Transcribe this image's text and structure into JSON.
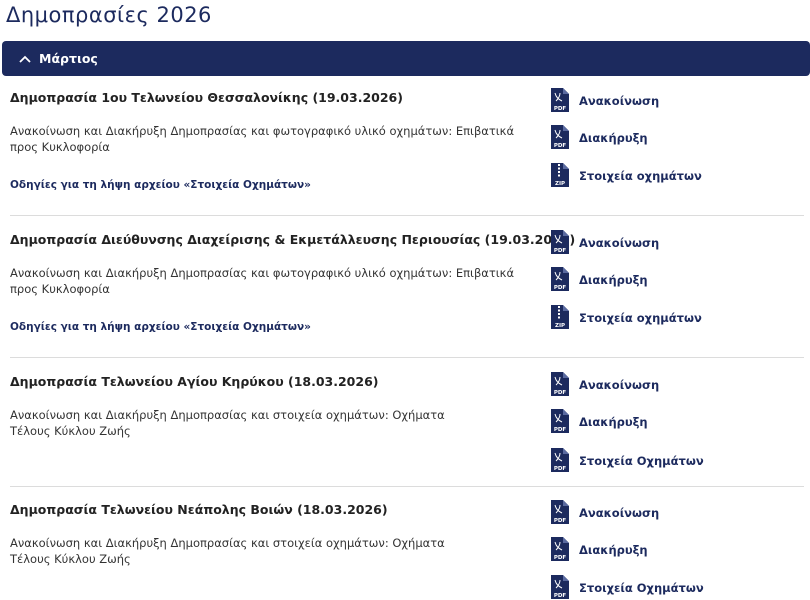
{
  "page": {
    "title": "Δημοπρασίες 2026"
  },
  "accordion": {
    "label": "Μάρτιος"
  },
  "colors": {
    "brand": "#1c2a5e",
    "divider": "#dcdcdc"
  },
  "entries": [
    {
      "title": "Δημοπρασία 1ου Τελωνείου Θεσσαλονίκης (19.03.2026)",
      "description": "Ανακοίνωση και Διακήρυξη Δημοπρασίας και φωτογραφικό υλικό οχημάτων: Επιβατικά προς Κυκλοφορία",
      "link": "Οδηγίες για τη λήψη αρχείου «Στοιχεία Οχημάτων»",
      "docs": [
        {
          "type": "PDF",
          "label": "Ανακοίνωση"
        },
        {
          "type": "PDF",
          "label": "Διακήρυξη"
        },
        {
          "type": "ZIP",
          "label": "Στοιχεία οχημάτων"
        }
      ]
    },
    {
      "title": "Δημοπρασία Διεύθυνσης Διαχείρισης & Εκμετάλλευσης Περιουσίας (19.03.2026)",
      "description": "Ανακοίνωση και Διακήρυξη Δημοπρασίας και φωτογραφικό υλικό οχημάτων: Επιβατικά προς Κυκλοφορία",
      "link": "Οδηγίες για τη λήψη αρχείου «Στοιχεία Οχημάτων»",
      "docs": [
        {
          "type": "PDF",
          "label": "Ανακοίνωση"
        },
        {
          "type": "PDF",
          "label": "Διακήρυξη"
        },
        {
          "type": "ZIP",
          "label": "Στοιχεία οχημάτων"
        }
      ]
    },
    {
      "title": "Δημοπρασία Τελωνείου Αγίου Κηρύκου (18.03.2026)",
      "description": "Ανακοίνωση και Διακήρυξη Δημοπρασίας και στοιχεία οχημάτων: Οχήματα Τέλους Κύκλου Ζωής",
      "docs": [
        {
          "type": "PDF",
          "label": "Ανακοίνωση"
        },
        {
          "type": "PDF",
          "label": "Διακήρυξη"
        },
        {
          "type": "PDF",
          "label": "Στοιχεία Οχημάτων"
        }
      ]
    },
    {
      "title": "Δημοπρασία Τελωνείου Νεάπολης Βοιών (18.03.2026)",
      "description": "Ανακοίνωση και Διακήρυξη Δημοπρασίας και στοιχεία οχημάτων: Οχήματα Τέλους Κύκλου Ζωής",
      "docs": [
        {
          "type": "PDF",
          "label": "Ανακοίνωση"
        },
        {
          "type": "PDF",
          "label": "Διακήρυξη"
        },
        {
          "type": "PDF",
          "label": "Στοιχεία Οχημάτων"
        }
      ]
    }
  ]
}
